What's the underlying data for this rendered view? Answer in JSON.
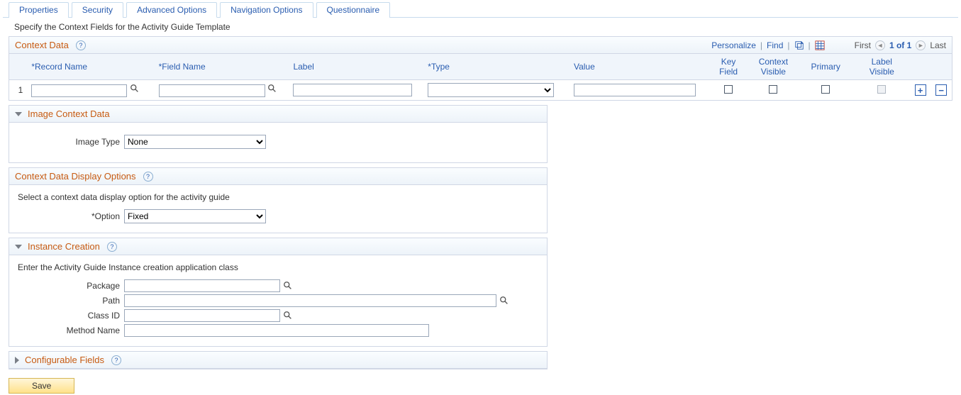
{
  "tabs": [
    {
      "label": "Properties"
    },
    {
      "label": "Security"
    },
    {
      "label": "Advanced Options"
    },
    {
      "label": "Navigation Options"
    },
    {
      "label": "Questionnaire"
    }
  ],
  "active_tab": 2,
  "instruction": "Specify the Context Fields for the Activity Guide Template",
  "context_data": {
    "title": "Context Data",
    "actions": {
      "personalize": "Personalize",
      "find": "Find",
      "first": "First",
      "last": "Last",
      "range": "1 of 1"
    },
    "columns": {
      "row_num": "",
      "record_name": "*Record Name",
      "field_name": "*Field Name",
      "label": "Label",
      "type": "*Type",
      "value": "Value",
      "key_field": "Key Field",
      "context_visible": "Context Visible",
      "primary": "Primary",
      "label_visible": "Label Visible"
    },
    "rows": [
      {
        "num": "1",
        "record_name": "",
        "field_name": "",
        "label": "",
        "type": "",
        "value": "",
        "key_field": false,
        "context_visible": false,
        "primary": false,
        "label_visible": false
      }
    ]
  },
  "image_context": {
    "title": "Image Context Data",
    "image_type_label": "Image Type",
    "image_type_value": "None"
  },
  "display_options": {
    "title": "Context Data Display Options",
    "desc": "Select a context data display option for the activity guide",
    "option_label": "*Option",
    "option_value": "Fixed"
  },
  "instance_creation": {
    "title": "Instance Creation",
    "desc": "Enter the Activity Guide Instance creation application class",
    "package_label": "Package",
    "package_value": "",
    "path_label": "Path",
    "path_value": "",
    "class_id_label": "Class ID",
    "class_id_value": "",
    "method_label": "Method Name",
    "method_value": ""
  },
  "configurable_fields": {
    "title": "Configurable Fields"
  },
  "buttons": {
    "save": "Save"
  }
}
